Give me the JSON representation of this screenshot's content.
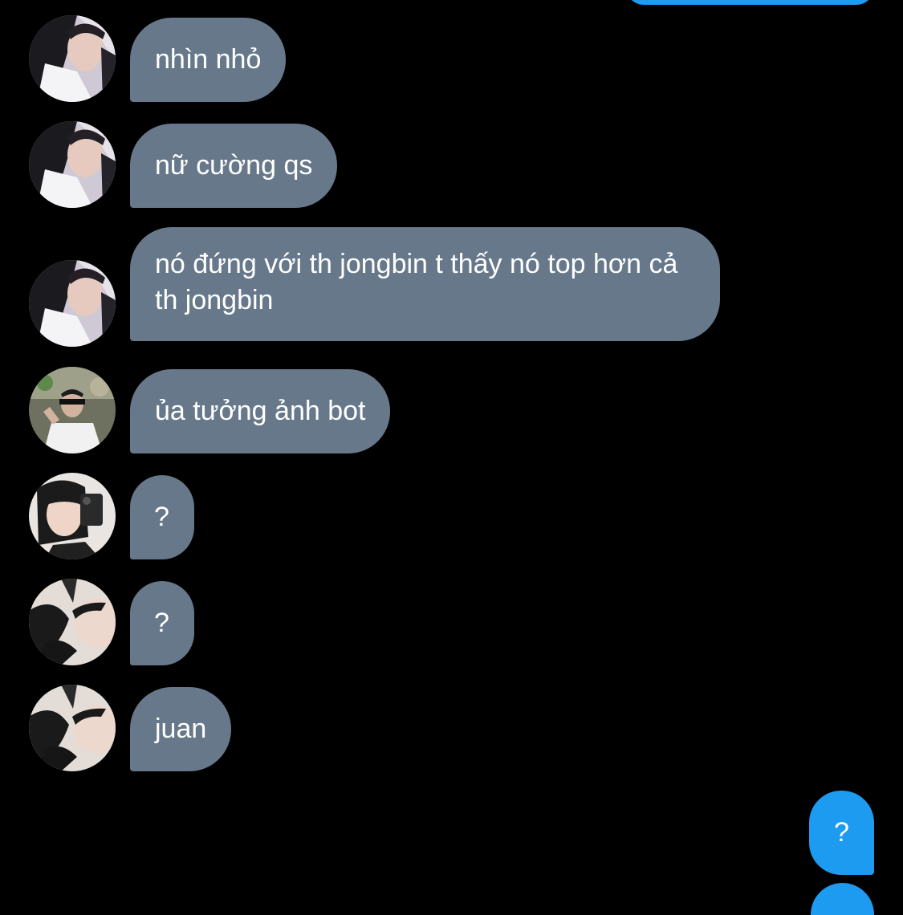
{
  "colors": {
    "background": "#000000",
    "incoming_bubble": "#66788a",
    "outgoing_bubble": "#1d9bf0",
    "text": "#ffffff"
  },
  "messages": [
    {
      "direction": "incoming",
      "avatar": "avatar-girl-white-top",
      "text": "nhìn nhỏ"
    },
    {
      "direction": "incoming",
      "avatar": "avatar-girl-white-top",
      "text": "nữ cường qs"
    },
    {
      "direction": "incoming",
      "avatar": "avatar-girl-white-top",
      "text": "nó đứng với th jongbin t thấy nó top hơn cả th jongbin"
    },
    {
      "direction": "incoming",
      "avatar": "avatar-girl-sunglasses",
      "text": "ủa tưởng ảnh bot"
    },
    {
      "direction": "incoming",
      "avatar": "avatar-girl-mirror-selfie",
      "text": "?"
    },
    {
      "direction": "incoming",
      "avatar": "avatar-girl-lying-down",
      "text": "?"
    },
    {
      "direction": "incoming",
      "avatar": "avatar-girl-lying-down",
      "text": "juan"
    },
    {
      "direction": "outgoing",
      "text": "?"
    }
  ]
}
